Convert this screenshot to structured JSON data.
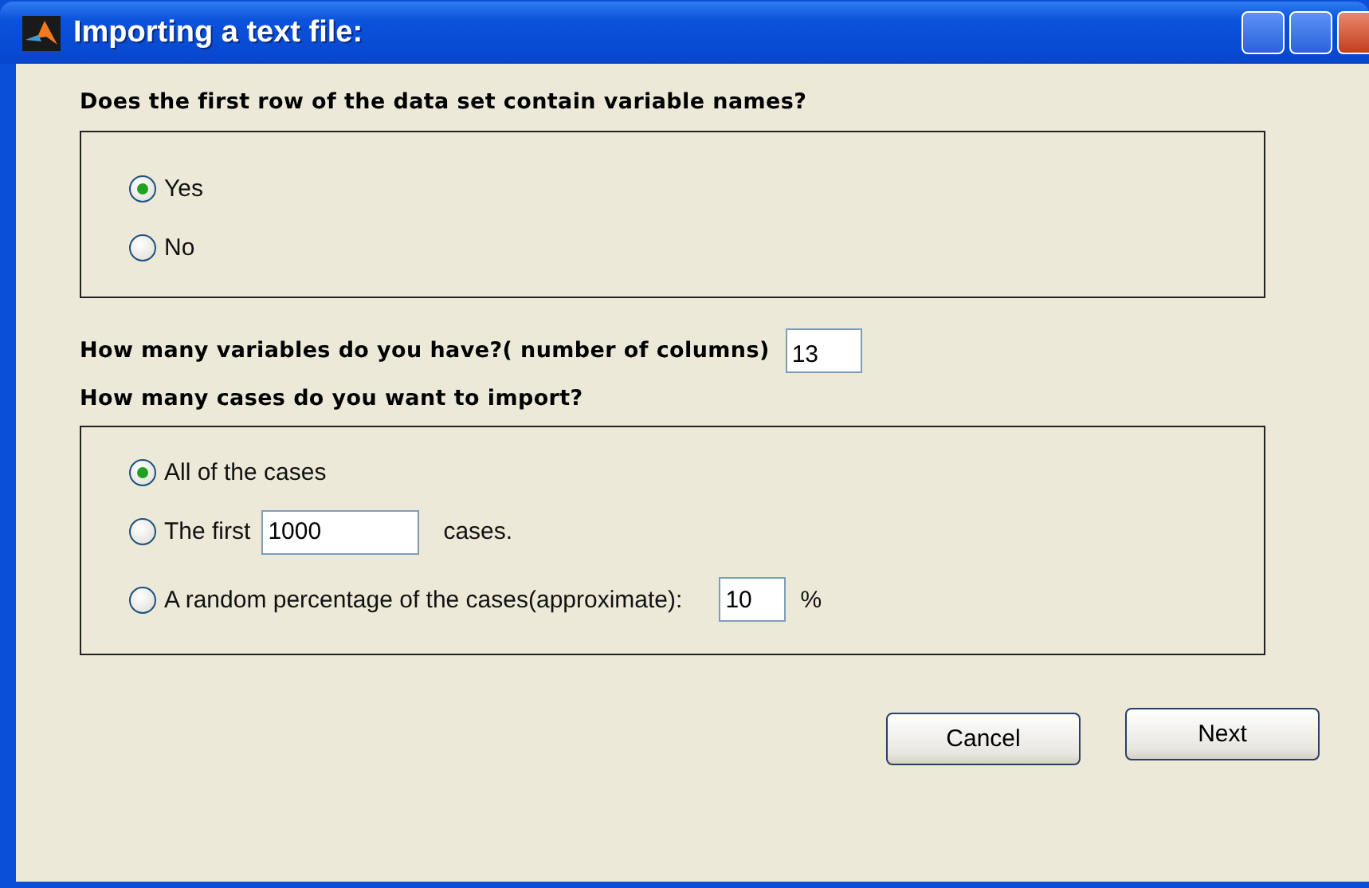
{
  "window": {
    "title": "Importing a text file:"
  },
  "header_question": {
    "label": "Does the first row of the data set contain variable names?",
    "options": [
      {
        "kind": "plain",
        "label": "Yes",
        "selected": true
      },
      {
        "kind": "plain",
        "label": "No",
        "selected": false
      }
    ]
  },
  "variables": {
    "label": "How many variables do you have?( number of columns)",
    "value": "13"
  },
  "cases_question": {
    "label": "How many cases do you want to import?",
    "options": [
      {
        "kind": "plain",
        "label": "All of the cases",
        "selected": true
      },
      {
        "kind": "count",
        "label": "The first",
        "value": "1000",
        "suffix": "cases.",
        "selected": false
      },
      {
        "kind": "percent",
        "label": "A random percentage of the cases(approximate):",
        "value": "10",
        "suffix": "%",
        "selected": false
      }
    ]
  },
  "buttons": [
    "Cancel",
    "Next"
  ]
}
